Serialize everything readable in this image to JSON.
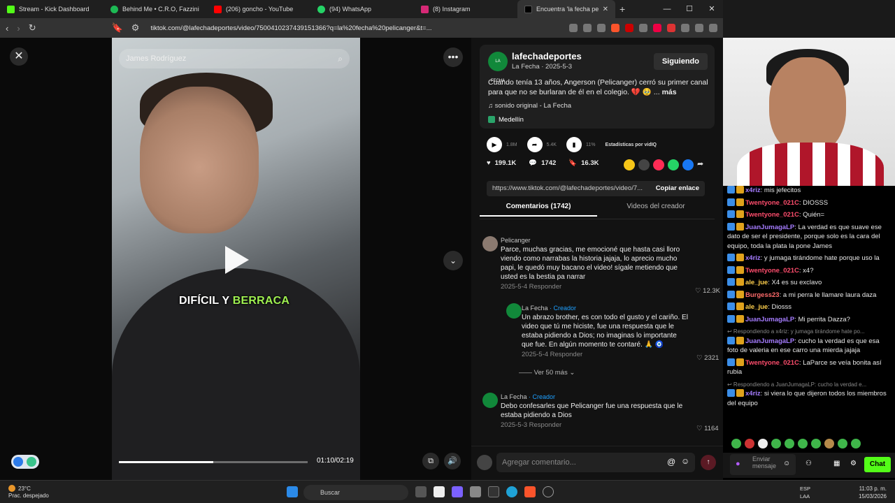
{
  "browser": {
    "tabs": [
      {
        "label": "Stream - Kick Dashboard",
        "color": "#53fc18"
      },
      {
        "label": "Behind Me • C.R.O, Fazzini",
        "color": "#1db954"
      },
      {
        "label": "(206) goncho - YouTube",
        "color": "#ff0000"
      },
      {
        "label": "(94) WhatsApp",
        "color": "#25d366"
      },
      {
        "label": "(8) Instagram",
        "color": "#d62976"
      },
      {
        "label": "Encuentra 'la fecha pelica",
        "color": "#000000"
      }
    ],
    "new_tab": "+",
    "url": "tiktok.com/@lafechadeportes/video/7500410237439151366?q=la%20fecha%20pelicanger&t=..."
  },
  "video": {
    "search_text": "James Rodríguez",
    "caption_word1": "DIFÍCIL Y",
    "caption_word2": "BERRACA",
    "time": "01:10/02:19",
    "progress": 0.5
  },
  "post": {
    "avatar_text": "LA FECHA",
    "username": "lafechadeportes",
    "subline": "La Fecha · 2025-5-3",
    "follow_label": "Siguiendo",
    "description": "Cuando tenía 13 años, Angerson (Pelicanger) cerró su primer canal para que no se burlaran de él en el colegio. 💔 🥹 ...",
    "more_label": "más",
    "sound": "♫  sonido original - La Fecha",
    "location": "Medellín",
    "stat_views": "1.8M",
    "stat_shares": "5.4K",
    "stat_pct": "11%",
    "stats_label": "Estadísticas por vidIQ",
    "likes": "199.1K",
    "comments": "1742",
    "saves": "16.3K",
    "link": "https://www.tiktok.com/@lafechadeportes/video/7...",
    "copy_label": "Copiar enlace",
    "tab_comments": "Comentarios (1742)",
    "tab_videos": "Videos del creador"
  },
  "comments": [
    {
      "name": "Pelicanger",
      "creator": "",
      "text": "Parce, muchas gracias, me emocioné que hasta casi lloro viendo como narrabas la historia jajaja, lo aprecio mucho papi, le quedó muy bacano el video! sígale metiendo que usted es la bestia pa narrar",
      "meta": "2025-5-4    Responder",
      "likes": "♡ 12.3K"
    },
    {
      "name": "La Fecha",
      "creator": " · Creador",
      "text": "Un abrazo brother, es con todo el gusto y el cariño. El video que tú me hiciste, fue una respuesta que le estaba pidiendo a Dios; no imaginas lo importante que fue. En algún momento te contaré. 🙏 🧿",
      "meta": "2025-5-4    Responder",
      "likes": "♡ 2321"
    },
    {
      "name": "La Fecha",
      "creator": " · Creador",
      "text": "Debo confesarles que Pelicanger fue una respuesta que le estaba pidiendo a Dios",
      "meta": "2025-5-3    Responder",
      "likes": "♡ 1164"
    }
  ],
  "more_replies": "—— Ver 50 más  ⌄",
  "add_comment": "Agregar comentario...",
  "chat": [
    {
      "user": "x4riz",
      "color": "#a57cff",
      "text": ": mis jefecitos",
      "reply": ""
    },
    {
      "user": "Twentyone_021C",
      "color": "#ff4d6d",
      "text": ": DIOSSS",
      "reply": ""
    },
    {
      "user": "Twentyone_021C",
      "color": "#ff4d6d",
      "text": ": Quién=",
      "reply": ""
    },
    {
      "user": "JuanJumagaLP",
      "color": "#a57cff",
      "text": ": La verdad es que suave ese dato de ser el presidente, porque solo es la cara del equipo, toda la plata la pone James",
      "reply": ""
    },
    {
      "user": "x4riz",
      "color": "#a57cff",
      "text": ": y jumaga tirándome hate porque uso la",
      "reply": ""
    },
    {
      "user": "Twentyone_021C",
      "color": "#ff4d6d",
      "text": ": x4?",
      "reply": ""
    },
    {
      "user": "ale_jue",
      "color": "#ffcf4d",
      "text": ": X4 es su exclavo",
      "reply": ""
    },
    {
      "user": "Burgess23",
      "color": "#ff6b6b",
      "text": ": a mi perra le llamare laura daza",
      "reply": ""
    },
    {
      "user": "ale_jue",
      "color": "#ffcf4d",
      "text": ": Diosss",
      "reply": ""
    },
    {
      "user": "JuanJumagaLP",
      "color": "#a57cff",
      "text": ": Mi perrita Dazza?",
      "reply": ""
    },
    {
      "user": "JuanJumagaLP",
      "color": "#a57cff",
      "text": ": cucho la verdad es que esa foto de valeria en ese carro una mierda jajaja",
      "reply": "↩ Respondiendo a x4riz: y jumaga tirándome hate po..."
    },
    {
      "user": "Twentyone_021C",
      "color": "#ff4d6d",
      "text": ": LaParce se veía bonita así rubia",
      "reply": ""
    },
    {
      "user": "x4riz",
      "color": "#a57cff",
      "text": ": si viera lo que dijeron todos los miembros del equipo",
      "reply": "↩ Respondiendo a JuanJumagaLP: cucho la verdad e..."
    }
  ],
  "chat_input": "Enviar mensaje",
  "chat_button": "Chat",
  "taskbar": {
    "temp": "23°C",
    "weather": "Prac. despejado",
    "search": "Buscar",
    "lang1": "ESP",
    "lang2": "LAA",
    "time": "11:03 p. m.",
    "date": "15/03/2026"
  }
}
